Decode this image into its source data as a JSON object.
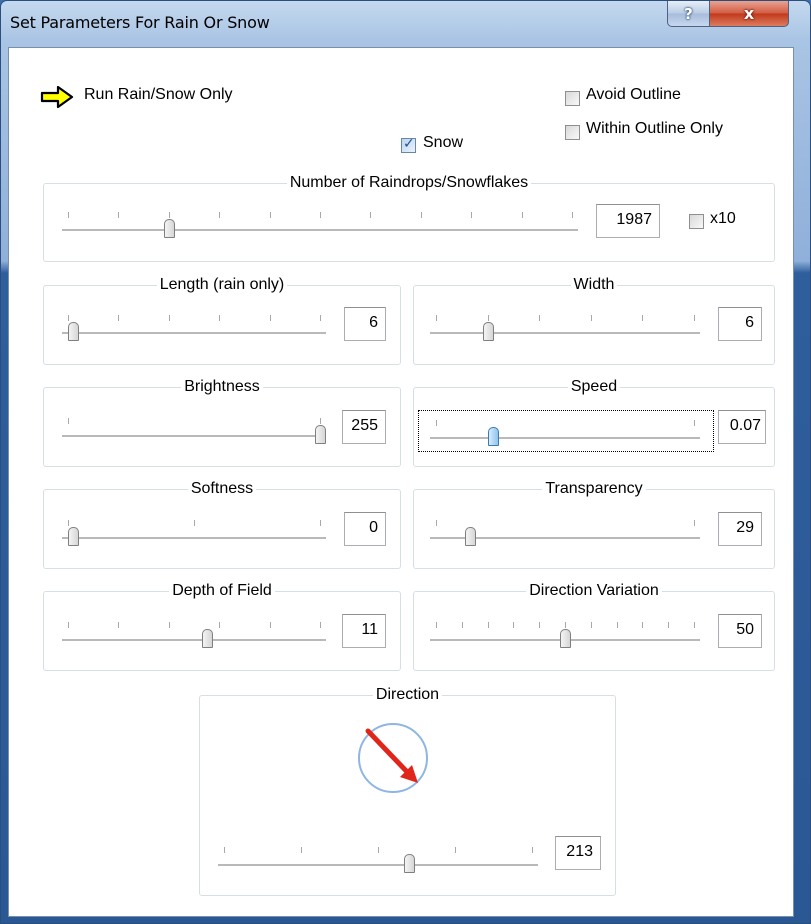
{
  "window": {
    "title": "Set Parameters For Rain Or Snow",
    "help_glyph": "?",
    "close_glyph": "x"
  },
  "options": {
    "run_label": "Run Rain/Snow Only",
    "snow_label": "Snow",
    "snow_checked": true,
    "avoid_outline_label": "Avoid Outline",
    "avoid_outline_checked": false,
    "within_outline_label": "Within Outline Only",
    "within_outline_checked": false
  },
  "groups": {
    "count": {
      "label": "Number of Raindrops/Snowflakes",
      "value": "1987",
      "x10_label": "x10",
      "x10_checked": false,
      "ticks": 11,
      "pos": 0.2
    },
    "length": {
      "label": "Length (rain only)",
      "value": "6",
      "ticks": 6,
      "pos": 0.02
    },
    "width": {
      "label": "Width",
      "value": "6",
      "ticks": 6,
      "pos": 0.2
    },
    "brightness": {
      "label": "Brightness",
      "value": "255",
      "ticks": 2,
      "pos": 1.0
    },
    "speed": {
      "label": "Speed",
      "value": "0.07",
      "ticks": 2,
      "pos": 0.22
    },
    "softness": {
      "label": "Softness",
      "value": "0",
      "ticks": 3,
      "pos": 0.02
    },
    "transparency": {
      "label": "Transparency",
      "value": "29",
      "ticks": 2,
      "pos": 0.13
    },
    "depth": {
      "label": "Depth of Field",
      "value": "11",
      "ticks": 6,
      "pos": 0.55
    },
    "direction_variation": {
      "label": "Direction Variation",
      "value": "50",
      "ticks": 11,
      "pos": 0.5
    },
    "direction": {
      "label": "Direction",
      "value": "213",
      "ticks": 5,
      "pos": 0.6
    }
  },
  "colors": {
    "arrow": "#e0261b",
    "dial": "#8fb6e3",
    "pointer": "#ffff00"
  }
}
